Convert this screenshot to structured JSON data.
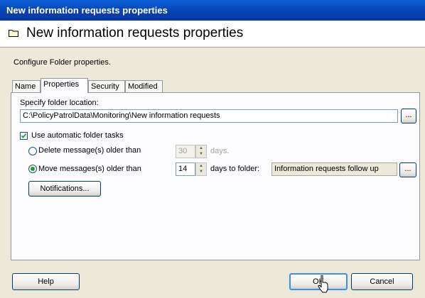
{
  "window": {
    "title": "New information requests properties"
  },
  "header": {
    "title": "New information requests properties",
    "icon": "folder-icon"
  },
  "description": "Configure Folder properties.",
  "tabs": [
    {
      "label": "Name"
    },
    {
      "label": "Properties",
      "active": true
    },
    {
      "label": "Security"
    },
    {
      "label": "Modified"
    }
  ],
  "properties": {
    "folder_location_label": "Specify folder location:",
    "folder_location_value": "C:\\PolicyPatrolData\\Monitoring\\New information requests",
    "browse_label": "...",
    "auto_tasks_label": "Use automatic folder tasks",
    "auto_tasks_checked": true,
    "delete_label": "Delete message(s) older than",
    "delete_days": "30",
    "delete_unit": "days.",
    "move_label": "Move messages(s) older than",
    "move_days": "14",
    "move_unit": "days to folder:",
    "move_folder_value": "Information requests follow up",
    "selected_option": "move",
    "notifications_label": "Notifications..."
  },
  "footer": {
    "help_label": "Help",
    "ok_label": "OK",
    "cancel_label": "Cancel"
  }
}
